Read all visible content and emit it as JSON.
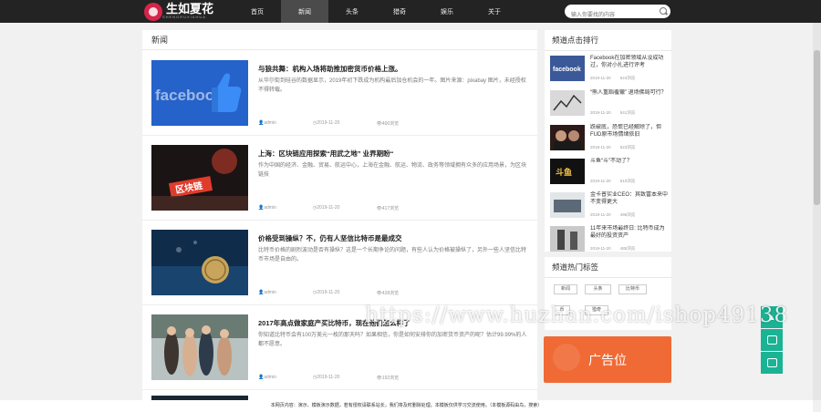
{
  "header": {
    "logo_text": "生如夏花",
    "logo_sub": "SHENGRUXIAHUA",
    "nav": [
      "首页",
      "新闻",
      "头条",
      "猎奇",
      "娱乐",
      "关于"
    ],
    "search_placeholder": "输入你要找的内容"
  },
  "main": {
    "section_title": "新闻",
    "articles": [
      {
        "title": "与狼共舞：机构入场将助推加密货币价格上涨。",
        "summary": "从华尔街到硅谷的数据显示，2019年初下跌成为机构最后加仓机会的一年。图片来源：pixabay 图片，未经授权不得转载。",
        "author": "admin",
        "date": "2019-11-20",
        "views": "400浏览"
      },
      {
        "title": "上海：区块链应用探索“用武之地” 业界期盼“",
        "summary": "作为中国的经济、金融、贸易、航运中心，上海在金融、航运、物流、政务等领域拥有众多的应用场景，为区块链技",
        "author": "admin",
        "date": "2019-11-20",
        "views": "417浏览"
      },
      {
        "title": "价格受到操纵？不，仍有人坚信比特币是最成交",
        "summary": "比特币价格的剧烈波动是否有操纵？这是一个长期争论的问题，有些人认为价格被操纵了，另外一些人坚信比特币市场是自由的。",
        "author": "admin",
        "date": "2019-11-20",
        "views": "428浏览"
      },
      {
        "title": "2017年高点做家庭产买比特币，现在他们怎么样了",
        "summary": "你知道比特币会有100万美元一枚的那天吗？如果相信，你是如何安排你的加密货币资产的呢？估计99.99%的人都不愿意。",
        "author": "admin",
        "date": "2019-11-20",
        "views": "192浏览"
      }
    ]
  },
  "sidebar": {
    "rank_title": "频道点击排行",
    "ranks": [
      {
        "title": "Facebook在加密领域从没成功过，你对小扎进行评考",
        "date": "2019-11-20",
        "views": "624浏览",
        "thumb_label": "facebook"
      },
      {
        "title": "“熊人重蹈覆辙” 退场佛局可行？",
        "date": "2019-11-20",
        "views": "541浏览"
      },
      {
        "title": "跌破底，恐慌已经解除了，但FUD原市场情绪依旧",
        "date": "2019-11-20",
        "views": "523浏览"
      },
      {
        "title": "斗鱼“斗”不动了？",
        "date": "2019-11-20",
        "views": "510浏览",
        "thumb_label": "斗鱼"
      },
      {
        "title": "金卡普实业CEO：其致富本来中不变得更大",
        "date": "2019-11-20",
        "views": "496浏览"
      },
      {
        "title": "11年来市场最终日: 比特币成为最好的投资资产",
        "date": "2019-11-20",
        "views": "485浏览"
      }
    ],
    "tags_title": "频道热门标签",
    "tags": [
      "新闻",
      "头条",
      "比特币",
      "币",
      "猎奇"
    ],
    "ad_text": "广告位"
  },
  "footer": {
    "text": "本网页内容：演示、模板演示数据，若有侵权请联系站长，我们将及时删除处理。本模板仅供学习交流使用。（本模板源码由鸟，搜索）"
  },
  "watermark": "https://www.huzhan.com/ishop49138",
  "colors": {
    "header_bg": "#232323",
    "accent_green": "#1ab394",
    "ad_orange": "#f06a35",
    "logo_red": "#d6254a"
  }
}
